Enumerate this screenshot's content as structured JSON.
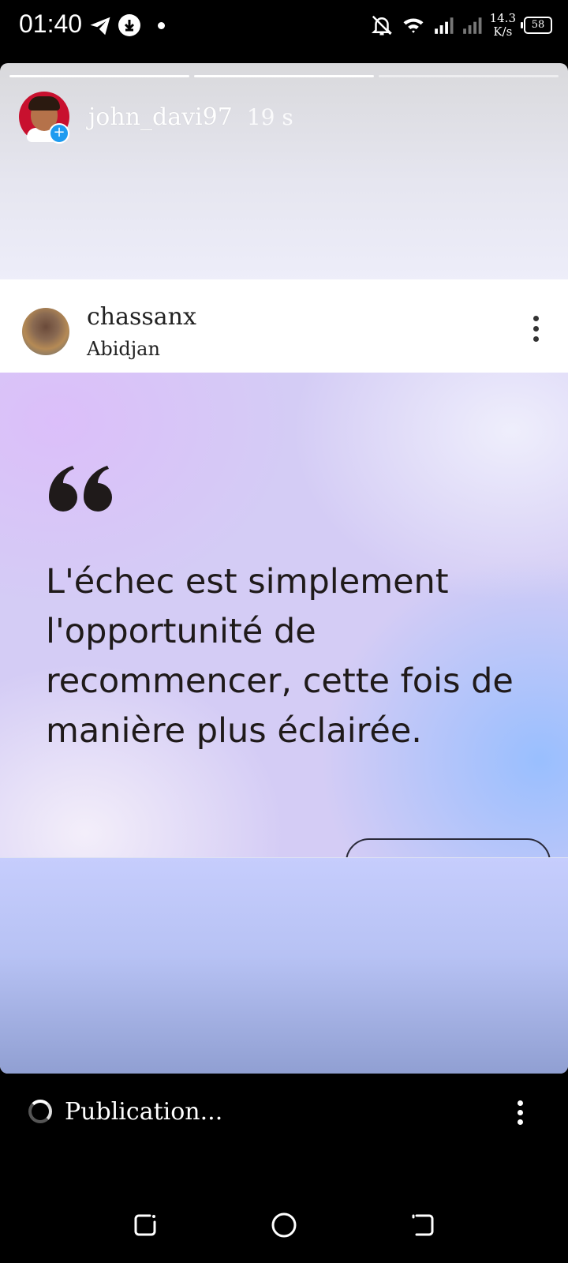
{
  "status_bar": {
    "time": "01:40",
    "icons": [
      "telegram-icon",
      "download-icon",
      "dot-icon",
      "bell-off-icon",
      "wifi-icon",
      "signal-icon",
      "signal-icon"
    ],
    "speed_value": "14.3",
    "speed_unit": "K/s",
    "battery": "58"
  },
  "story": {
    "progress_segments": [
      1,
      1,
      0
    ],
    "username": "john_davi97",
    "time_ago": "19 s",
    "post": {
      "username": "chassanx",
      "location": "Abidjan",
      "quote": "L'échec est simplement l'opportunité de recommencer, cette fois de manière plus éclairée."
    }
  },
  "publish_bar": {
    "label": "Publication..."
  },
  "nav": {
    "buttons": [
      "recent-apps-icon",
      "home-icon",
      "back-icon"
    ]
  },
  "colors": {
    "accent_blue": "#1d9bf0",
    "background": "#000000"
  }
}
